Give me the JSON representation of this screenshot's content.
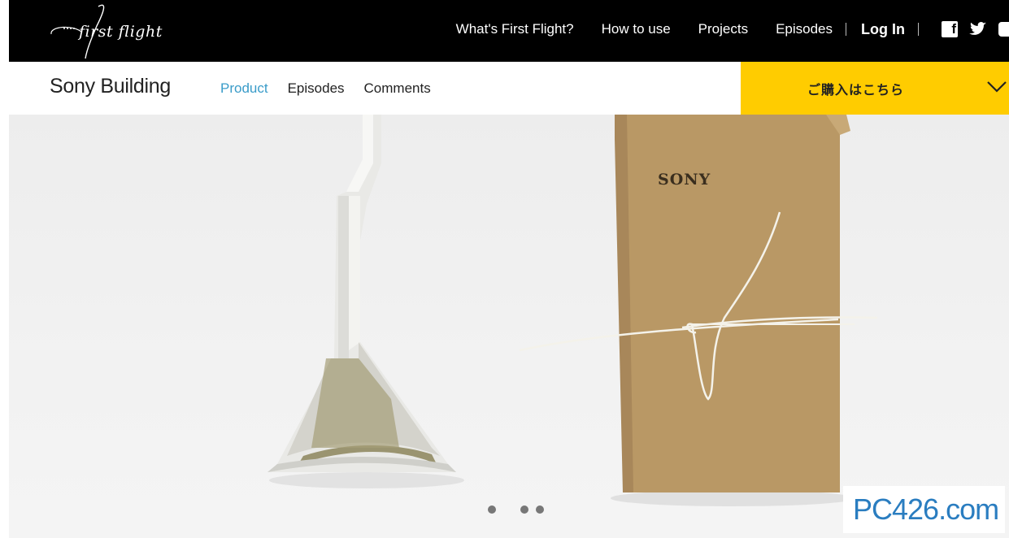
{
  "header": {
    "logo_text": "first flight",
    "nav": [
      "What's First Flight?",
      "How to use",
      "Projects",
      "Episodes"
    ],
    "login_label": "Log In",
    "social_icons": [
      "facebook-icon",
      "twitter-icon",
      "youtube-icon"
    ]
  },
  "subheader": {
    "title": "Sony Building",
    "tabs": [
      {
        "label": "Product",
        "active": true
      },
      {
        "label": "Episodes",
        "active": false
      },
      {
        "label": "Comments",
        "active": false
      }
    ],
    "buy_label": "ご購入はこちら",
    "buy_color": "#ffcc00",
    "active_color": "#3a9cc9"
  },
  "hero": {
    "box_brand": "SONY",
    "carousel_dots": 3
  },
  "watermark": {
    "text": "PC426.com"
  }
}
